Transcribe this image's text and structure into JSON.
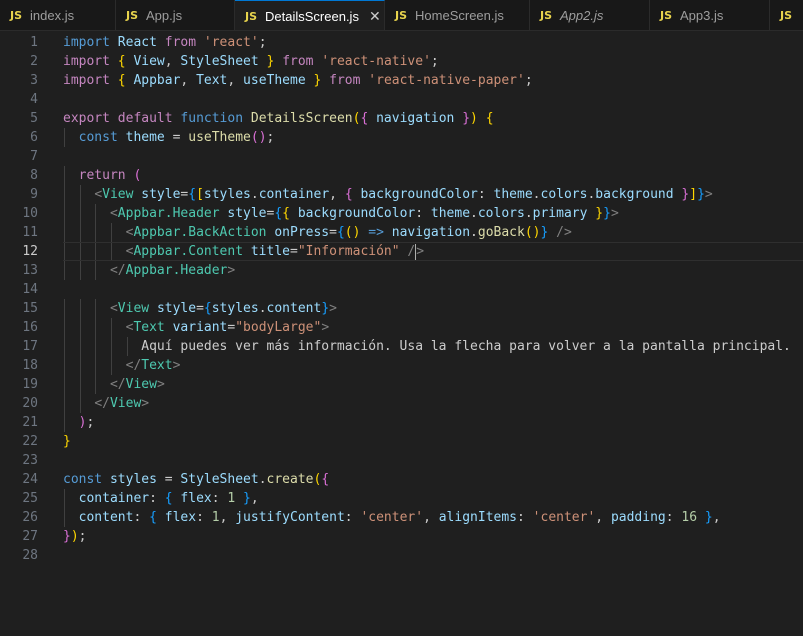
{
  "tabs": [
    {
      "name": "index-js",
      "label": "index.js",
      "icon": "JS",
      "active": false,
      "width": 116
    },
    {
      "name": "app-js",
      "label": "App.js",
      "icon": "JS",
      "active": false,
      "width": 119
    },
    {
      "name": "details-screen-js",
      "label": "DetailsScreen.js",
      "icon": "JS",
      "active": true,
      "width": 150,
      "close": "✕"
    },
    {
      "name": "home-screen-js",
      "label": "HomeScreen.js",
      "icon": "JS",
      "active": false,
      "width": 145
    },
    {
      "name": "app2-js",
      "label": "App2.js",
      "icon": "JS",
      "active": false,
      "width": 120,
      "italic": true
    },
    {
      "name": "app3-js",
      "label": "App3.js",
      "icon": "JS",
      "active": false,
      "width": 120
    },
    {
      "name": "overflow-js",
      "label": "",
      "icon": "JS",
      "active": false,
      "width": 60
    }
  ],
  "editor": {
    "current_line": 12,
    "lines": [
      [
        [
          "kw",
          "import"
        ],
        [
          "pl",
          " "
        ],
        [
          "var",
          "React"
        ],
        [
          "pl",
          " "
        ],
        [
          "ctl",
          "from"
        ],
        [
          "pl",
          " "
        ],
        [
          "str",
          "'react'"
        ],
        [
          "pl",
          ";"
        ]
      ],
      [
        [
          "ctl",
          "import"
        ],
        [
          "pl",
          " "
        ],
        [
          "br1",
          "{"
        ],
        [
          "pl",
          " "
        ],
        [
          "var",
          "View"
        ],
        [
          "pl",
          ", "
        ],
        [
          "var",
          "StyleSheet"
        ],
        [
          "pl",
          " "
        ],
        [
          "br1",
          "}"
        ],
        [
          "pl",
          " "
        ],
        [
          "ctl",
          "from"
        ],
        [
          "pl",
          " "
        ],
        [
          "str",
          "'react-native'"
        ],
        [
          "pl",
          ";"
        ]
      ],
      [
        [
          "ctl",
          "import"
        ],
        [
          "pl",
          " "
        ],
        [
          "br1",
          "{"
        ],
        [
          "pl",
          " "
        ],
        [
          "var",
          "Appbar"
        ],
        [
          "pl",
          ", "
        ],
        [
          "var",
          "Text"
        ],
        [
          "pl",
          ", "
        ],
        [
          "var",
          "useTheme"
        ],
        [
          "pl",
          " "
        ],
        [
          "br1",
          "}"
        ],
        [
          "pl",
          " "
        ],
        [
          "ctl",
          "from"
        ],
        [
          "pl",
          " "
        ],
        [
          "str",
          "'react-native-paper'"
        ],
        [
          "pl",
          ";"
        ]
      ],
      [],
      [
        [
          "ctl",
          "export"
        ],
        [
          "pl",
          " "
        ],
        [
          "ctl",
          "default"
        ],
        [
          "pl",
          " "
        ],
        [
          "kw",
          "function"
        ],
        [
          "pl",
          " "
        ],
        [
          "fn",
          "DetailsScreen"
        ],
        [
          "br1",
          "("
        ],
        [
          "br2",
          "{"
        ],
        [
          "pl",
          " "
        ],
        [
          "var",
          "navigation"
        ],
        [
          "pl",
          " "
        ],
        [
          "br2",
          "}"
        ],
        [
          "br1",
          ")"
        ],
        [
          "pl",
          " "
        ],
        [
          "br1",
          "{"
        ]
      ],
      [
        [
          "pl",
          "  "
        ],
        [
          "kw",
          "const"
        ],
        [
          "pl",
          " "
        ],
        [
          "var",
          "theme"
        ],
        [
          "pl",
          " = "
        ],
        [
          "fn",
          "useTheme"
        ],
        [
          "br2",
          "()"
        ],
        [
          "pl",
          ";"
        ]
      ],
      [],
      [
        [
          "pl",
          "  "
        ],
        [
          "ctl",
          "return"
        ],
        [
          "pl",
          " "
        ],
        [
          "br2",
          "("
        ]
      ],
      [
        [
          "pl",
          "    "
        ],
        [
          "ang",
          "<"
        ],
        [
          "tag",
          "View"
        ],
        [
          "pl",
          " "
        ],
        [
          "var",
          "style"
        ],
        [
          "pl",
          "="
        ],
        [
          "br3",
          "{"
        ],
        [
          "br1",
          "["
        ],
        [
          "var",
          "styles"
        ],
        [
          "pl",
          "."
        ],
        [
          "var",
          "container"
        ],
        [
          "pl",
          ", "
        ],
        [
          "br2",
          "{"
        ],
        [
          "pl",
          " "
        ],
        [
          "var",
          "backgroundColor"
        ],
        [
          "pl",
          ": "
        ],
        [
          "var",
          "theme"
        ],
        [
          "pl",
          "."
        ],
        [
          "var",
          "colors"
        ],
        [
          "pl",
          "."
        ],
        [
          "var",
          "background"
        ],
        [
          "pl",
          " "
        ],
        [
          "br2",
          "}"
        ],
        [
          "br1",
          "]"
        ],
        [
          "br3",
          "}"
        ],
        [
          "ang",
          ">"
        ]
      ],
      [
        [
          "pl",
          "      "
        ],
        [
          "ang",
          "<"
        ],
        [
          "tag",
          "Appbar.Header"
        ],
        [
          "pl",
          " "
        ],
        [
          "var",
          "style"
        ],
        [
          "pl",
          "="
        ],
        [
          "br3",
          "{"
        ],
        [
          "br1",
          "{"
        ],
        [
          "pl",
          " "
        ],
        [
          "var",
          "backgroundColor"
        ],
        [
          "pl",
          ": "
        ],
        [
          "var",
          "theme"
        ],
        [
          "pl",
          "."
        ],
        [
          "var",
          "colors"
        ],
        [
          "pl",
          "."
        ],
        [
          "var",
          "primary"
        ],
        [
          "pl",
          " "
        ],
        [
          "br1",
          "}"
        ],
        [
          "br3",
          "}"
        ],
        [
          "ang",
          ">"
        ]
      ],
      [
        [
          "pl",
          "        "
        ],
        [
          "ang",
          "<"
        ],
        [
          "tag",
          "Appbar.BackAction"
        ],
        [
          "pl",
          " "
        ],
        [
          "var",
          "onPress"
        ],
        [
          "pl",
          "="
        ],
        [
          "br3",
          "{"
        ],
        [
          "br1",
          "()"
        ],
        [
          "pl",
          " "
        ],
        [
          "kw",
          "=>"
        ],
        [
          "pl",
          " "
        ],
        [
          "var",
          "navigation"
        ],
        [
          "pl",
          "."
        ],
        [
          "fn",
          "goBack"
        ],
        [
          "br1",
          "()"
        ],
        [
          "br3",
          "}"
        ],
        [
          "pl",
          " "
        ],
        [
          "ang",
          "/>"
        ]
      ],
      [
        [
          "pl",
          "        "
        ],
        [
          "ang",
          "<"
        ],
        [
          "tag",
          "Appbar.Content"
        ],
        [
          "pl",
          " "
        ],
        [
          "var",
          "title"
        ],
        [
          "pl",
          "="
        ],
        [
          "str",
          "\"Información\""
        ],
        [
          "pl",
          " "
        ],
        [
          "ang",
          "/"
        ],
        [
          "cursor",
          ""
        ],
        [
          "ang",
          ">"
        ]
      ],
      [
        [
          "pl",
          "      "
        ],
        [
          "ang",
          "</"
        ],
        [
          "tag",
          "Appbar.Header"
        ],
        [
          "ang",
          ">"
        ]
      ],
      [],
      [
        [
          "pl",
          "      "
        ],
        [
          "ang",
          "<"
        ],
        [
          "tag",
          "View"
        ],
        [
          "pl",
          " "
        ],
        [
          "var",
          "style"
        ],
        [
          "pl",
          "="
        ],
        [
          "br3",
          "{"
        ],
        [
          "var",
          "styles"
        ],
        [
          "pl",
          "."
        ],
        [
          "var",
          "content"
        ],
        [
          "br3",
          "}"
        ],
        [
          "ang",
          ">"
        ]
      ],
      [
        [
          "pl",
          "        "
        ],
        [
          "ang",
          "<"
        ],
        [
          "tag",
          "Text"
        ],
        [
          "pl",
          " "
        ],
        [
          "var",
          "variant"
        ],
        [
          "pl",
          "="
        ],
        [
          "str",
          "\"bodyLarge\""
        ],
        [
          "ang",
          ">"
        ]
      ],
      [
        [
          "pl",
          "          Aquí puedes ver más información. Usa la flecha para volver a la pantalla principal."
        ]
      ],
      [
        [
          "pl",
          "        "
        ],
        [
          "ang",
          "</"
        ],
        [
          "tag",
          "Text"
        ],
        [
          "ang",
          ">"
        ]
      ],
      [
        [
          "pl",
          "      "
        ],
        [
          "ang",
          "</"
        ],
        [
          "tag",
          "View"
        ],
        [
          "ang",
          ">"
        ]
      ],
      [
        [
          "pl",
          "    "
        ],
        [
          "ang",
          "</"
        ],
        [
          "tag",
          "View"
        ],
        [
          "ang",
          ">"
        ]
      ],
      [
        [
          "pl",
          "  "
        ],
        [
          "br2",
          ")"
        ],
        [
          "pl",
          ";"
        ]
      ],
      [
        [
          "br1",
          "}"
        ]
      ],
      [],
      [
        [
          "kw",
          "const"
        ],
        [
          "pl",
          " "
        ],
        [
          "var",
          "styles"
        ],
        [
          "pl",
          " = "
        ],
        [
          "var",
          "StyleSheet"
        ],
        [
          "pl",
          "."
        ],
        [
          "fn",
          "create"
        ],
        [
          "br1",
          "("
        ],
        [
          "br2",
          "{"
        ]
      ],
      [
        [
          "pl",
          "  "
        ],
        [
          "var",
          "container"
        ],
        [
          "pl",
          ": "
        ],
        [
          "br3",
          "{"
        ],
        [
          "pl",
          " "
        ],
        [
          "var",
          "flex"
        ],
        [
          "pl",
          ": "
        ],
        [
          "num",
          "1"
        ],
        [
          "pl",
          " "
        ],
        [
          "br3",
          "}"
        ],
        [
          "pl",
          ","
        ]
      ],
      [
        [
          "pl",
          "  "
        ],
        [
          "var",
          "content"
        ],
        [
          "pl",
          ": "
        ],
        [
          "br3",
          "{"
        ],
        [
          "pl",
          " "
        ],
        [
          "var",
          "flex"
        ],
        [
          "pl",
          ": "
        ],
        [
          "num",
          "1"
        ],
        [
          "pl",
          ", "
        ],
        [
          "var",
          "justifyContent"
        ],
        [
          "pl",
          ": "
        ],
        [
          "str",
          "'center'"
        ],
        [
          "pl",
          ", "
        ],
        [
          "var",
          "alignItems"
        ],
        [
          "pl",
          ": "
        ],
        [
          "str",
          "'center'"
        ],
        [
          "pl",
          ", "
        ],
        [
          "var",
          "padding"
        ],
        [
          "pl",
          ": "
        ],
        [
          "num",
          "16"
        ],
        [
          "pl",
          " "
        ],
        [
          "br3",
          "}"
        ],
        [
          "pl",
          ","
        ]
      ],
      [
        [
          "br2",
          "}"
        ],
        [
          "br1",
          ")"
        ],
        [
          "pl",
          ";"
        ]
      ],
      []
    ]
  }
}
